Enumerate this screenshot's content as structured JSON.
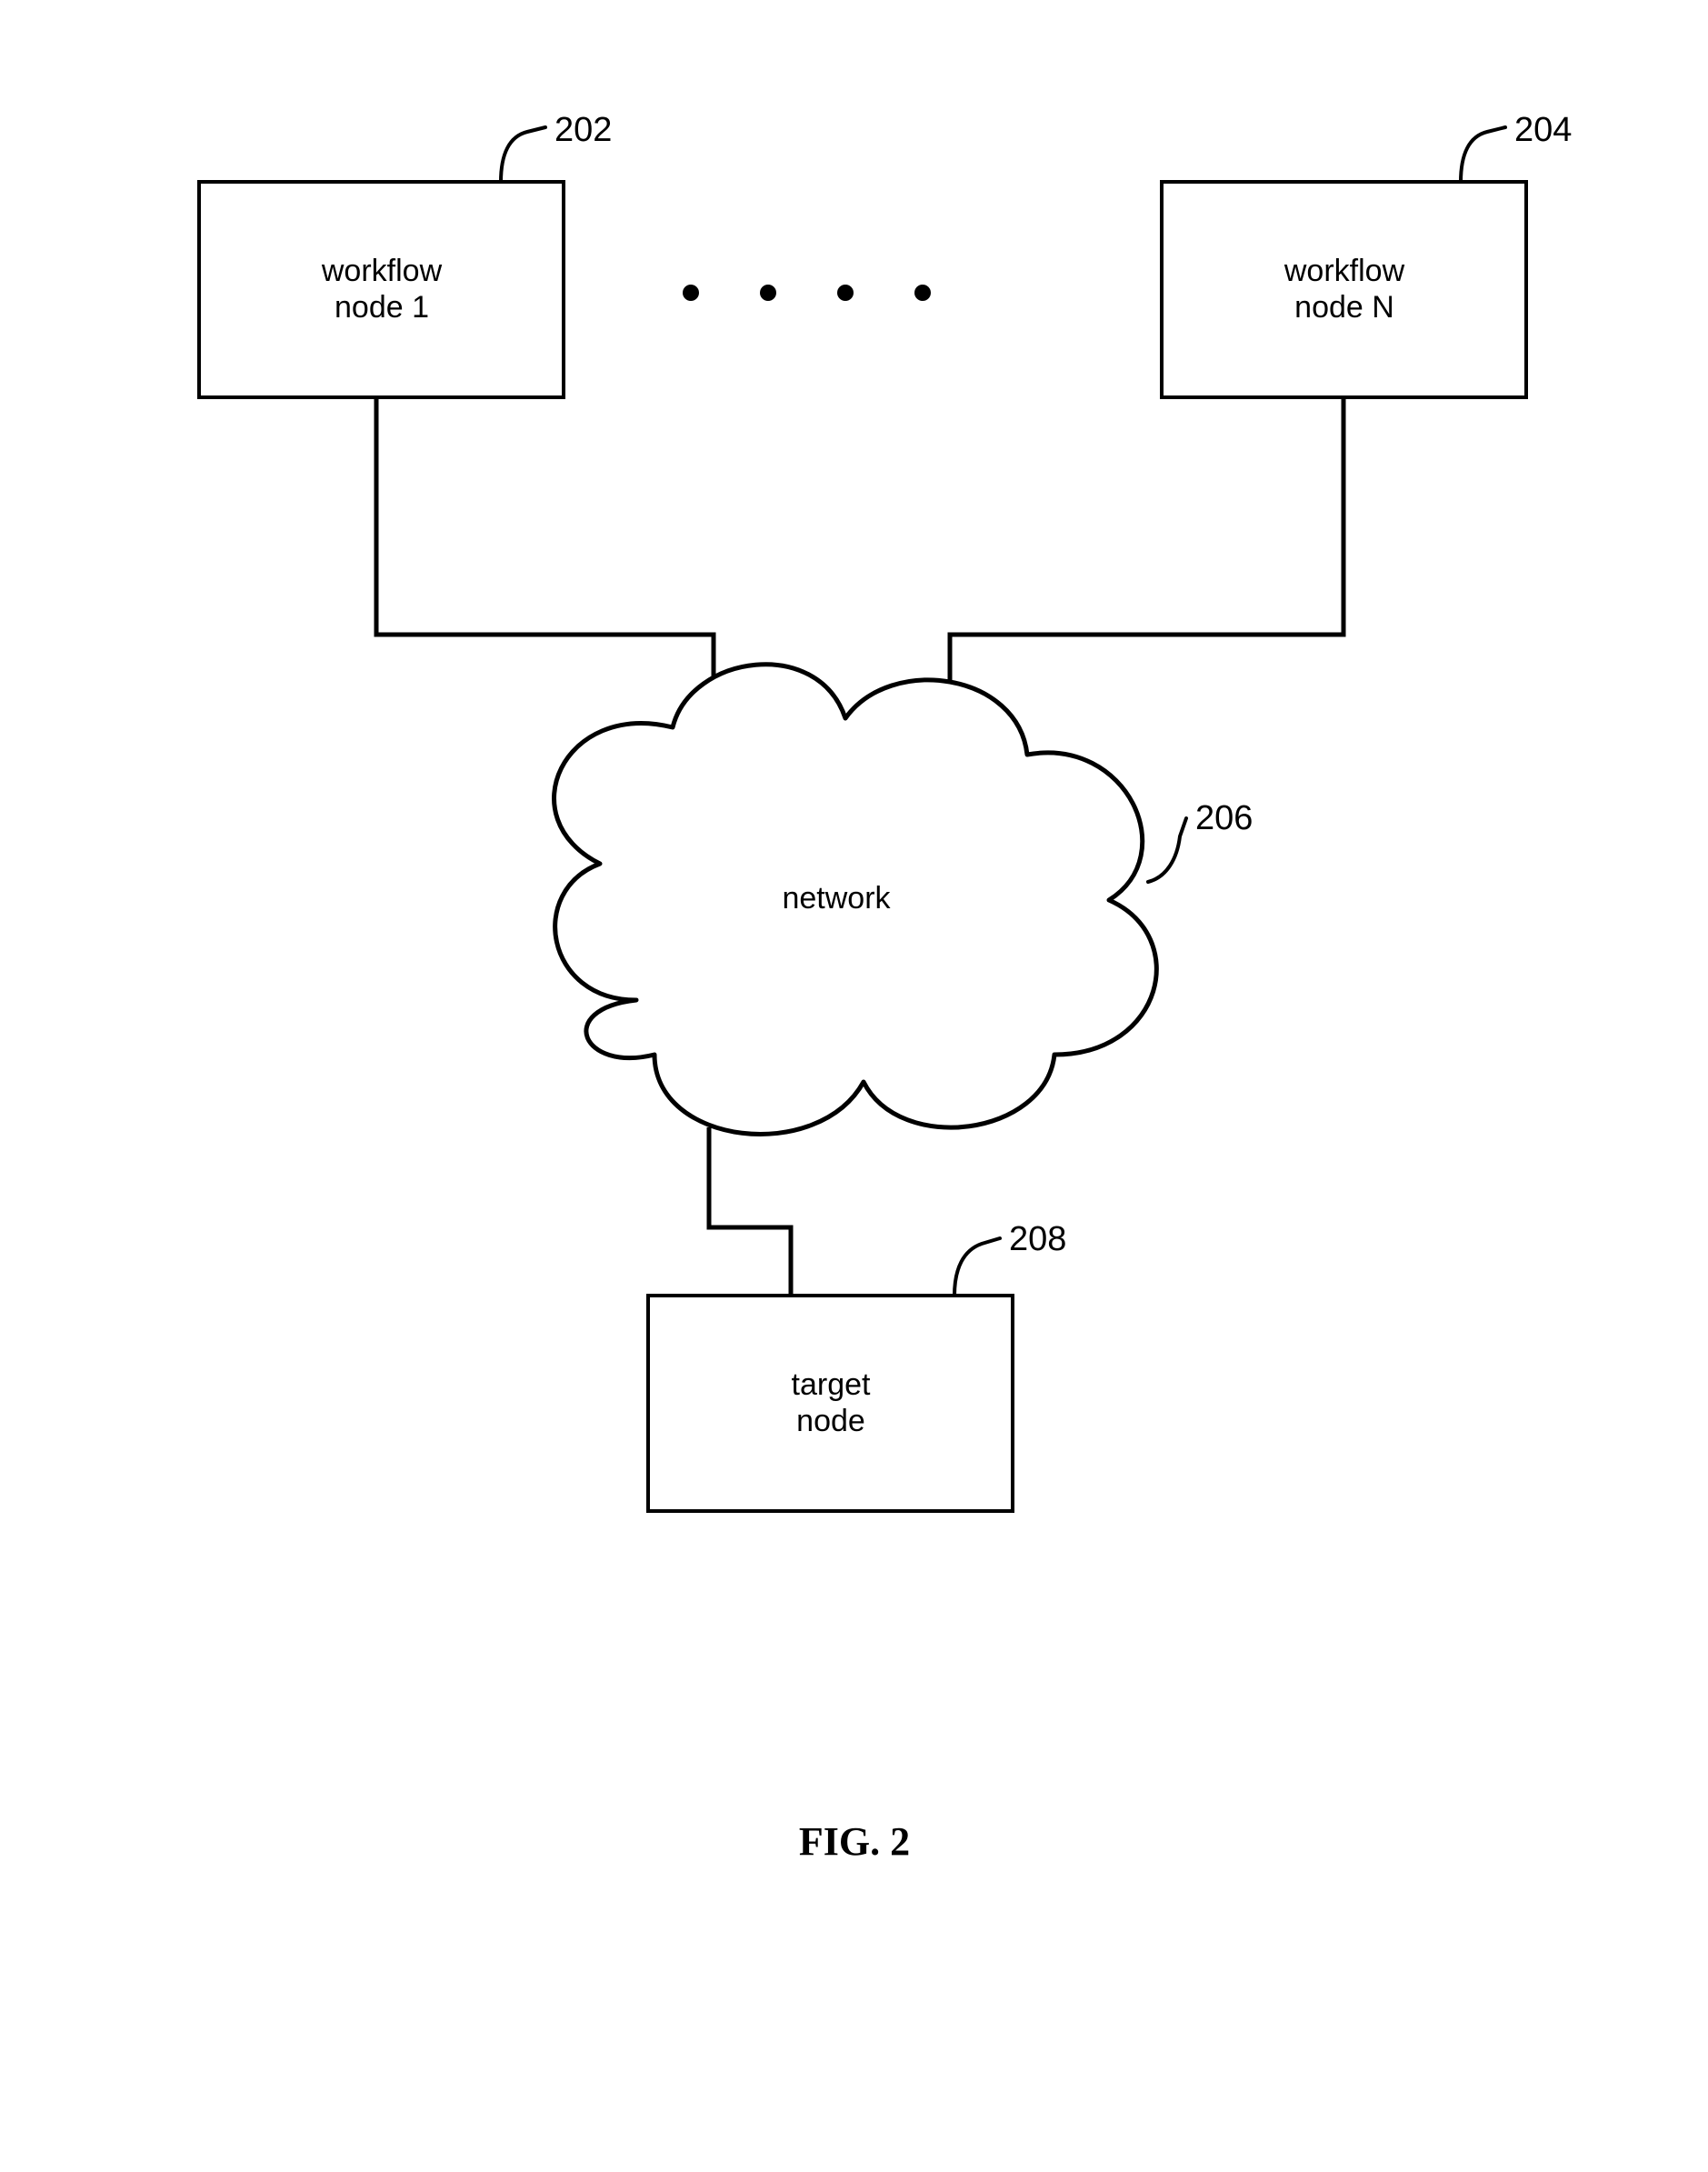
{
  "nodes": {
    "workflow1": {
      "line1": "workflow",
      "line2": "node 1",
      "ref": "202"
    },
    "workflowN": {
      "line1": "workflow",
      "line2": "node N",
      "ref": "204"
    },
    "network": {
      "label": "network",
      "ref": "206"
    },
    "target": {
      "line1": "target",
      "line2": "node",
      "ref": "208"
    }
  },
  "caption": "FIG. 2"
}
